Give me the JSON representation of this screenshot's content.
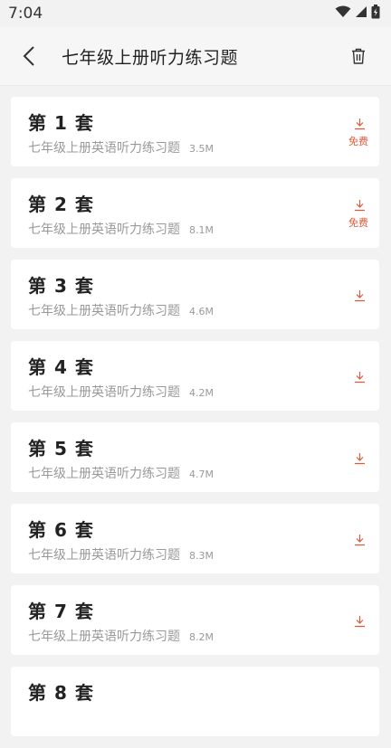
{
  "status": {
    "time": "7:04"
  },
  "header": {
    "title": "七年级上册听力练习题"
  },
  "colors": {
    "accent": "#e05a3a",
    "background": "#f2f2f2",
    "card": "#ffffff"
  },
  "items": [
    {
      "title": "第 1 套",
      "subtitle": "七年级上册英语听力练习题",
      "size": "3.5M",
      "badge": "免费"
    },
    {
      "title": "第 2 套",
      "subtitle": "七年级上册英语听力练习题",
      "size": "8.1M",
      "badge": "免费"
    },
    {
      "title": "第 3 套",
      "subtitle": "七年级上册英语听力练习题",
      "size": "4.6M",
      "badge": ""
    },
    {
      "title": "第 4 套",
      "subtitle": "七年级上册英语听力练习题",
      "size": "4.2M",
      "badge": ""
    },
    {
      "title": "第 5 套",
      "subtitle": "七年级上册英语听力练习题",
      "size": "4.7M",
      "badge": ""
    },
    {
      "title": "第 6 套",
      "subtitle": "七年级上册英语听力练习题",
      "size": "8.3M",
      "badge": ""
    },
    {
      "title": "第 7 套",
      "subtitle": "七年级上册英语听力练习题",
      "size": "8.2M",
      "badge": ""
    },
    {
      "title": "第 8 套",
      "subtitle": "",
      "size": "",
      "badge": ""
    }
  ],
  "icons": {
    "back": "back-arrow-icon",
    "delete": "trash-icon",
    "download": "download-icon",
    "wifi": "wifi-icon",
    "signal": "signal-icon",
    "battery": "battery-icon"
  }
}
